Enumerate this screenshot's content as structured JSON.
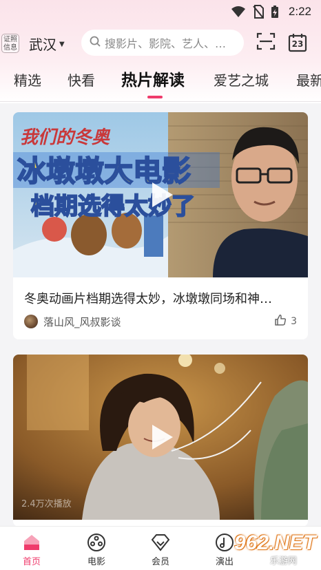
{
  "status_bar": {
    "time": "2:22"
  },
  "header": {
    "license_label": "证照\n信息",
    "city": "武汉",
    "search_placeholder": "搜影片、影院、艺人、…",
    "calendar_day": "23"
  },
  "tabs": [
    {
      "label": "精选",
      "active": false
    },
    {
      "label": "快看",
      "active": false
    },
    {
      "label": "热片解读",
      "active": true
    },
    {
      "label": "爱艺之城",
      "active": false
    },
    {
      "label": "最新",
      "active": false
    }
  ],
  "cards": [
    {
      "poster_title_art": "我们的冬奥",
      "overlay_line1": "冰墩墩大电影",
      "overlay_line2": "档期选得太妙了",
      "title": "冬奥动画片档期选得太妙，冰墩墩同场和神…",
      "author": "落山风_风叔影谈",
      "likes": "3"
    },
    {
      "views": "2.4万次播放"
    }
  ],
  "bottom_nav": [
    {
      "label": "首页",
      "active": true
    },
    {
      "label": "电影",
      "active": false
    },
    {
      "label": "会员",
      "active": false
    },
    {
      "label": "演出",
      "active": false
    }
  ],
  "watermark": {
    "brand": "962.NET",
    "sub": "乐游网"
  },
  "colors": {
    "accent": "#ef3b6b",
    "header_bg": "#fbe3ea"
  }
}
